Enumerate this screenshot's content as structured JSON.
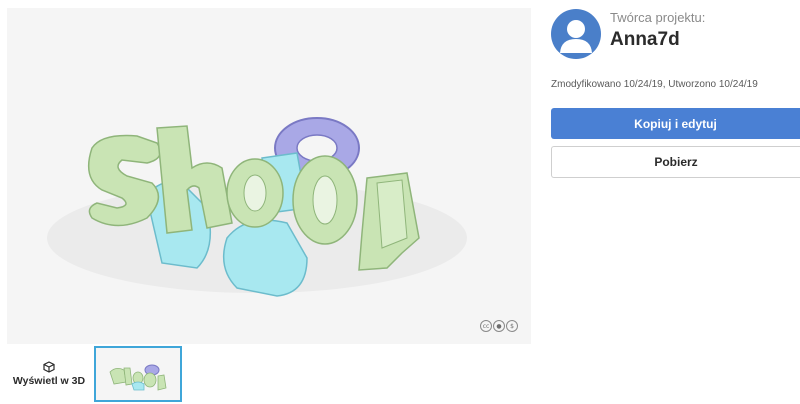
{
  "viewer": {
    "model_text": "Shool",
    "license_icons": [
      "cc-icon",
      "attribution-icon",
      "noncommercial-icon"
    ]
  },
  "thumbnails": {
    "view3d_label": "Wyświetl w 3D"
  },
  "creator": {
    "label": "Twórca projektu:",
    "name": "Anna7d"
  },
  "dates": "Zmodyfikowano 10/24/19, Utworzono 10/24/19",
  "actions": {
    "copy_edit_label": "Kopiuj i edytuj",
    "download_label": "Pobierz"
  },
  "colors": {
    "primary": "#4a80d4",
    "letter_green": "#c9e4b4",
    "letter_cyan": "#a8e8f0",
    "letter_purple": "#b9b8ee",
    "thumb_border": "#3fa6d9"
  }
}
